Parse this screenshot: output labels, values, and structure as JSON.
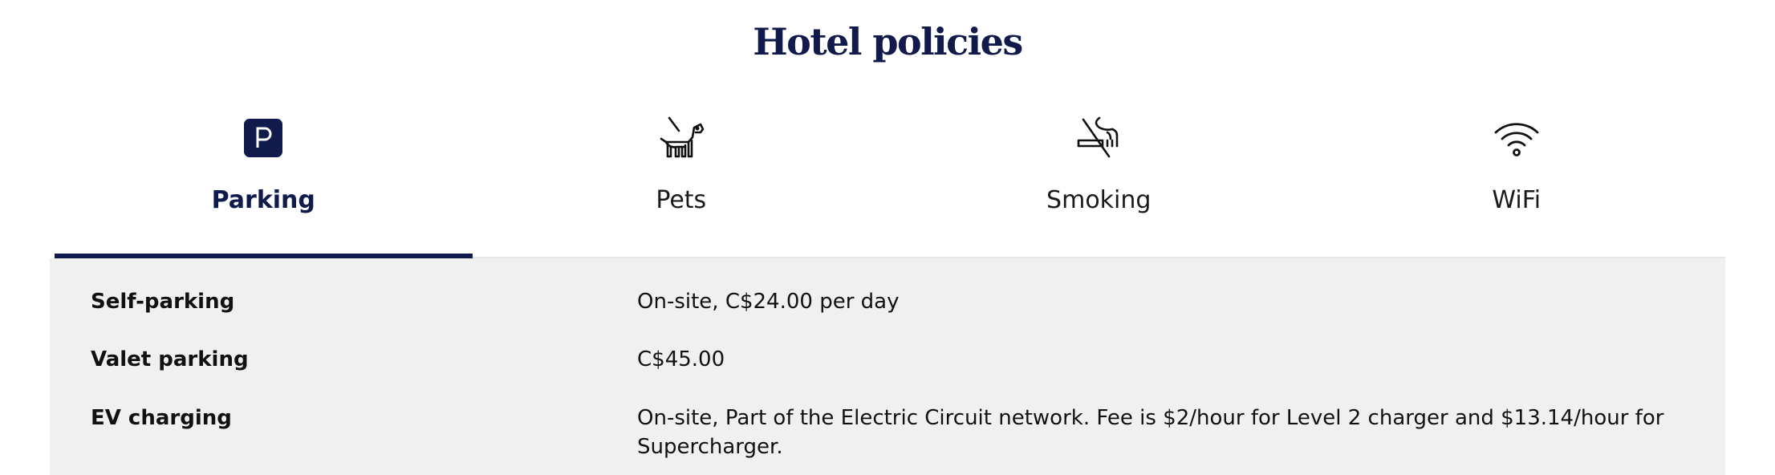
{
  "page": {
    "title": "Hotel policies"
  },
  "tabs": [
    {
      "label": "Parking",
      "icon": "parking-icon",
      "active": true
    },
    {
      "label": "Pets",
      "icon": "dog-icon",
      "active": false
    },
    {
      "label": "Smoking",
      "icon": "no-smoking-icon",
      "active": false
    },
    {
      "label": "WiFi",
      "icon": "wifi-icon",
      "active": false
    }
  ],
  "parking": {
    "rows": [
      {
        "label": "Self-parking",
        "value": "On-site, C$24.00 per day"
      },
      {
        "label": "Valet parking",
        "value": "C$45.00"
      },
      {
        "label": "EV charging",
        "value": "On-site, Part of the Electric Circuit network. Fee is $2/hour for Level 2 charger and $13.14/hour for Supercharger."
      }
    ]
  },
  "colors": {
    "brand_navy": "#101b4c",
    "panel_bg": "#f0f0f0",
    "text": "#111111"
  }
}
